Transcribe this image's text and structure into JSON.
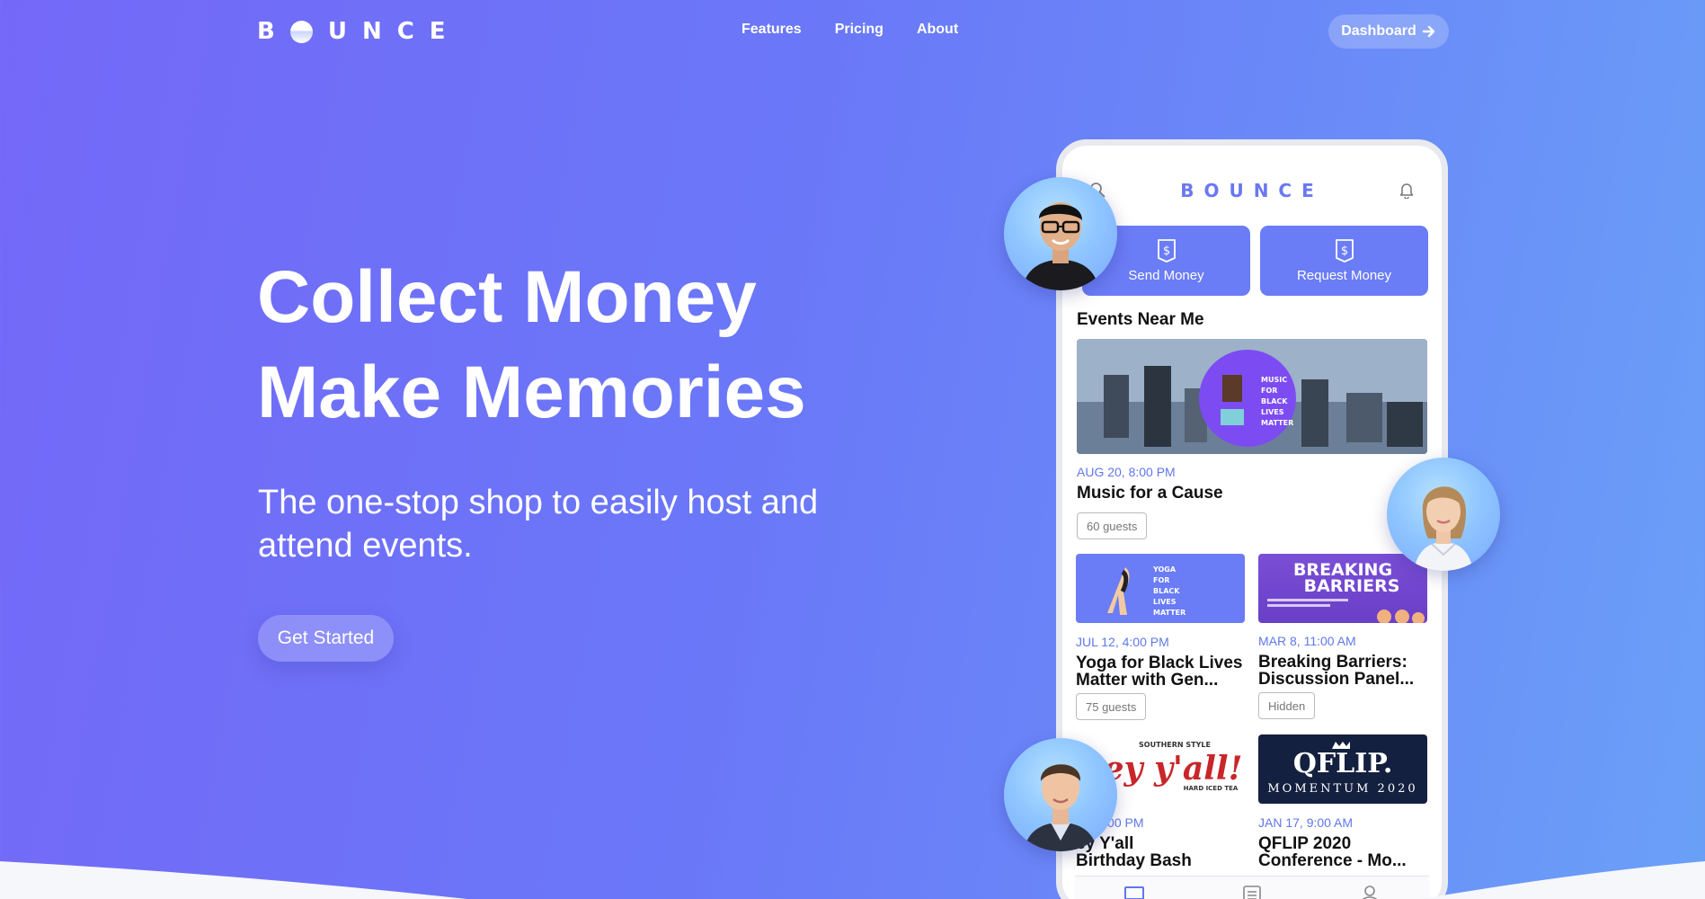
{
  "brand": {
    "name": "BOUNCE",
    "letters_rest": "UNCE"
  },
  "nav": {
    "links": [
      "Features",
      "Pricing",
      "About"
    ],
    "dashboard_label": "Dashboard"
  },
  "hero": {
    "line1": "Collect Money",
    "line2": "Make Memories",
    "subtitle": "The one-stop shop to easily host and attend events.",
    "cta_label": "Get Started"
  },
  "phone": {
    "logo": "BOUNCE",
    "actions": [
      {
        "label": "Send Money",
        "icon": "dollar-doc-icon"
      },
      {
        "label": "Request Money",
        "icon": "dollar-doc-icon"
      }
    ],
    "section_title": "Events Near Me",
    "featured": {
      "date": "AUG 20, 8:00 PM",
      "title": "Music for a Cause",
      "badge": "60 guests",
      "image_text": [
        "MUSIC",
        "FOR",
        "BLACK",
        "LIVES",
        "MATTER"
      ]
    },
    "events": [
      {
        "date": "JUL 12, 4:00 PM",
        "title_l1": "Yoga for Black Lives",
        "title_l2": "Matter with Gen...",
        "badge": "75 guests",
        "image_text": [
          "YOGA",
          "FOR",
          "BLACK",
          "LIVES",
          "MATTER"
        ]
      },
      {
        "date": "MAR 8, 11:00 AM",
        "title_l1": "Breaking Barriers:",
        "title_l2": "Discussion Panel...",
        "badge": "Hidden",
        "image_text": [
          "BREAKING",
          "BARRIERS"
        ]
      },
      {
        "date": "9, 12:00 PM",
        "title_l1": "ey Y'all",
        "title_l2": "Birthday Bash",
        "image_text": [
          "SOUTHERN STYLE",
          "ey y'all!",
          "HARD ICED TEA"
        ]
      },
      {
        "date": "JAN 17, 9:00 AM",
        "title_l1": "QFLIP 2020",
        "title_l2": "Conference - Mo...",
        "image_text": [
          "QFLIP.",
          "MOMENTUM 2020"
        ]
      }
    ],
    "tabs": [
      "home-tab-icon",
      "list-tab-icon",
      "profile-tab-icon"
    ]
  },
  "colors": {
    "accent": "#6a7cf6",
    "date_blue": "#5e78ea",
    "bg_start": "#7468f8",
    "bg_end": "#6aa0f8"
  }
}
